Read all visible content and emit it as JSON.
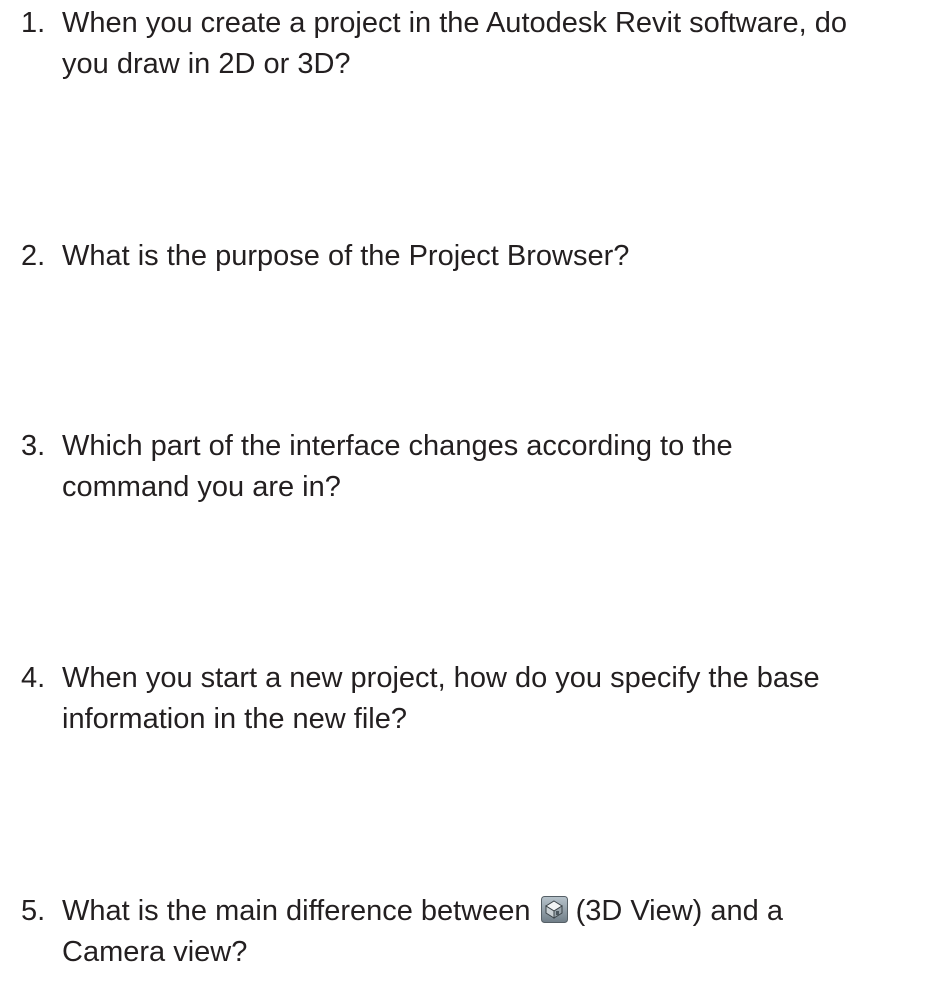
{
  "questions": [
    {
      "number": "1.",
      "lines": [
        "When you create a project in the Autodesk Revit software, do",
        "you draw in 2D or 3D?"
      ]
    },
    {
      "number": "2.",
      "lines": [
        "What is the purpose of the Project Browser?"
      ]
    },
    {
      "number": "3.",
      "lines": [
        "Which part of the interface changes according to the",
        "command you are in?"
      ]
    },
    {
      "number": "4.",
      "lines": [
        "When you start a new project, how do you specify the base",
        "information in the new file?"
      ]
    },
    {
      "number": "5.",
      "line1_before_icon": "What is the main difference between",
      "line1_after_icon": "(3D View) and a",
      "line2": "Camera view?",
      "icon": "3d-view-house-icon"
    }
  ]
}
